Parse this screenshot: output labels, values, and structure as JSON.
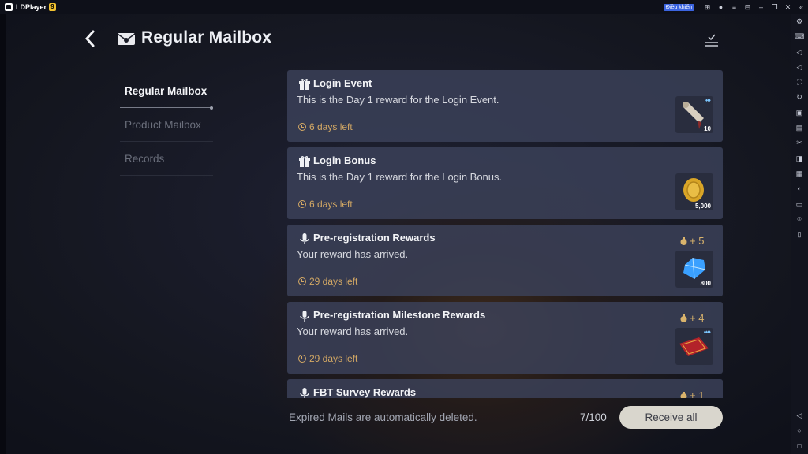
{
  "app": {
    "name": "LDPlayer",
    "badge": "9",
    "control_label": "Điều khiển"
  },
  "header": {
    "title": "Regular Mailbox"
  },
  "nav": {
    "items": [
      {
        "label": "Regular Mailbox",
        "active": true
      },
      {
        "label": "Product Mailbox",
        "active": false
      },
      {
        "label": "Records",
        "active": false
      }
    ]
  },
  "mails": [
    {
      "title": "Login Event",
      "subtitle": "This is the Day 1 reward for the Login Event.",
      "time_left": "6 days left",
      "reward_qty": "10",
      "reward_item": "scroll-icon",
      "bonus": ""
    },
    {
      "title": "Login Bonus",
      "subtitle": "This is the Day 1 reward for the Login Bonus.",
      "time_left": "6 days left",
      "reward_qty": "5,000",
      "reward_item": "gold-coin-icon",
      "bonus": ""
    },
    {
      "title": "Pre-registration Rewards",
      "subtitle": "Your reward has arrived.",
      "time_left": "29 days left",
      "reward_qty": "800",
      "reward_item": "blue-gem-icon",
      "bonus": "+ 5"
    },
    {
      "title": "Pre-registration Milestone Rewards",
      "subtitle": "Your reward has arrived.",
      "time_left": "29 days left",
      "reward_qty": "",
      "reward_item": "ticket-icon",
      "bonus": "+ 4"
    },
    {
      "title": "FBT Survey Rewards",
      "subtitle": "",
      "time_left": "",
      "reward_qty": "",
      "reward_item": "",
      "bonus": "+ 1"
    }
  ],
  "footer": {
    "note": "Expired Mails are automatically deleted.",
    "count": "7/100",
    "receive_all_label": "Receive all"
  },
  "colors": {
    "accent_gold": "#d3a864",
    "card_bg": "#3c425a",
    "button_bg": "#d9d6cd"
  }
}
